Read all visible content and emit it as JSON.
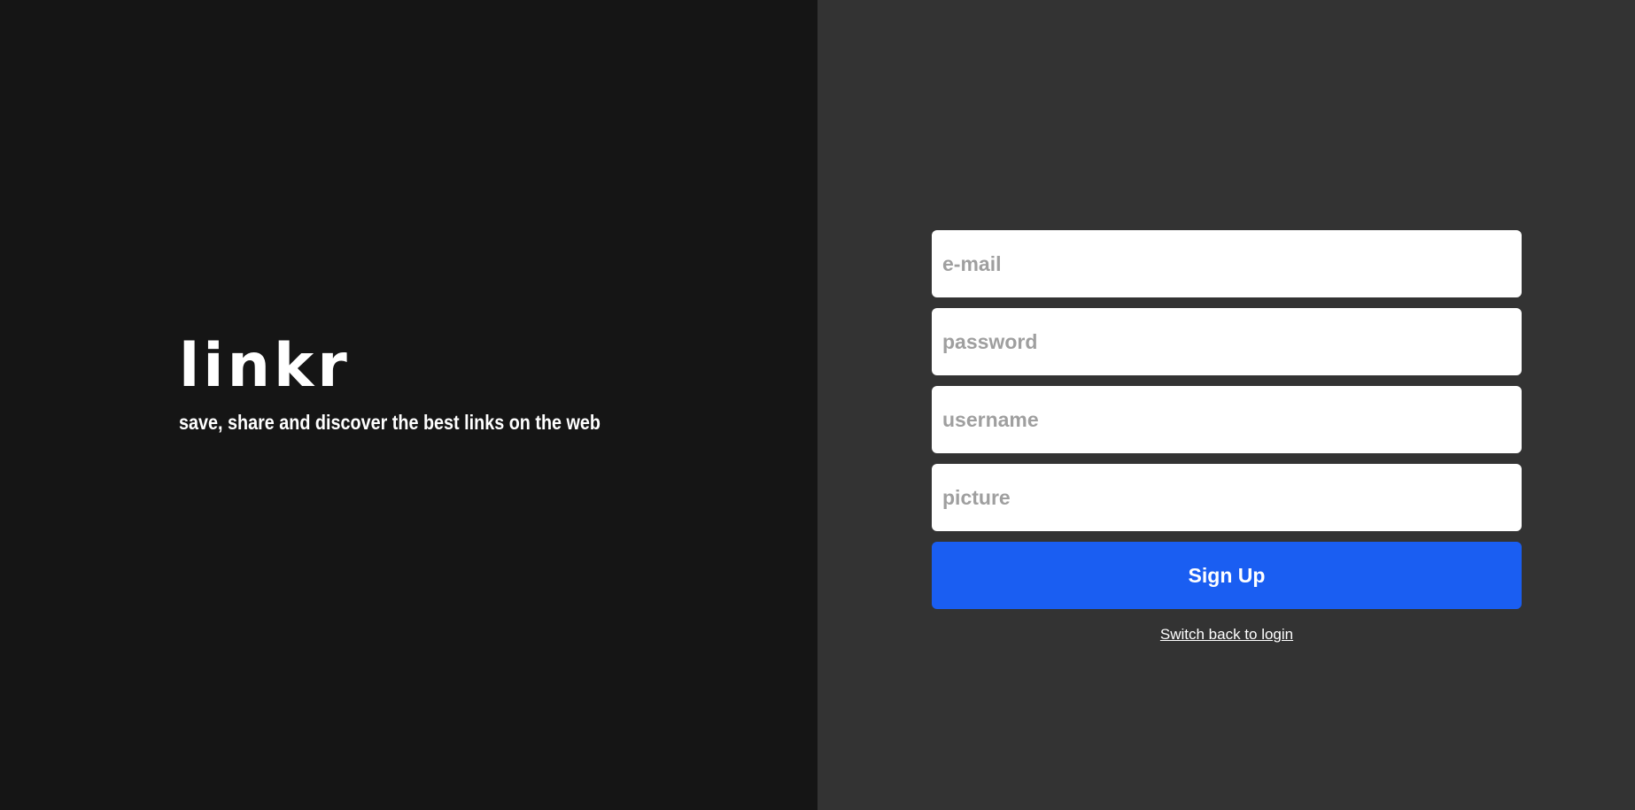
{
  "brand": {
    "logo": "linkr",
    "tagline": "save, share and discover the best links on the web"
  },
  "form": {
    "email_placeholder": "e-mail",
    "password_placeholder": "password",
    "username_placeholder": "username",
    "picture_placeholder": "picture",
    "submit_label": "Sign Up",
    "switch_label": "Switch back to login"
  },
  "colors": {
    "left_background": "#151515",
    "right_background": "#333333",
    "button_background": "#1a5ef2",
    "input_background": "#ffffff",
    "placeholder_text": "#9f9f9f"
  }
}
